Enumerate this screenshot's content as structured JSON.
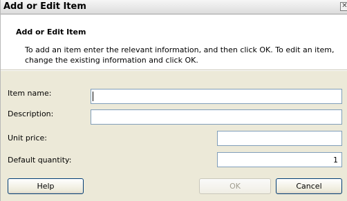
{
  "window": {
    "title": "Add or Edit Item",
    "close_glyph": "✕"
  },
  "banner": {
    "title": "Add or Edit Item",
    "description": "To add an item enter the relevant information, and then click OK. To edit an item, change the existing information and click OK."
  },
  "form": {
    "item_name": {
      "label": "Item name:",
      "value": ""
    },
    "description": {
      "label": "Description:",
      "value": ""
    },
    "unit_price": {
      "label": "Unit price:",
      "value": ""
    },
    "default_quantity": {
      "label": "Default quantity:",
      "value": "1"
    }
  },
  "buttons": {
    "help": "Help",
    "ok": "OK",
    "cancel": "Cancel"
  }
}
